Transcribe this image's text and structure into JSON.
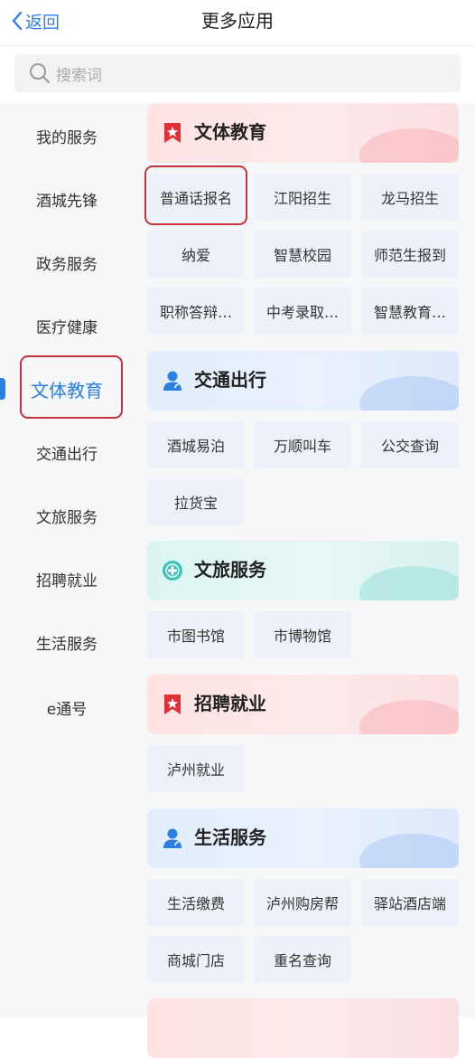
{
  "header": {
    "back_label": "返回",
    "title": "更多应用"
  },
  "search": {
    "placeholder": "搜索词"
  },
  "sidebar": {
    "items": [
      {
        "label": "我的服务"
      },
      {
        "label": "酒城先锋"
      },
      {
        "label": "政务服务"
      },
      {
        "label": "医疗健康"
      },
      {
        "label": "文体教育",
        "active": true
      },
      {
        "label": "交通出行"
      },
      {
        "label": "文旅服务"
      },
      {
        "label": "招聘就业"
      },
      {
        "label": "生活服务"
      },
      {
        "label": "e通号"
      }
    ]
  },
  "sections": [
    {
      "title": "文体教育",
      "icon": "bookmark-star-icon",
      "theme": "red",
      "apps": [
        "普通话报名",
        "江阳招生",
        "龙马招生",
        "纳爱",
        "智慧校园",
        "师范生报到",
        "职称答辩…",
        "中考录取…",
        "智慧教育…"
      ]
    },
    {
      "title": "交通出行",
      "icon": "person-icon",
      "theme": "blue",
      "apps": [
        "酒城易泊",
        "万顺叫车",
        "公交查询",
        "拉货宝"
      ]
    },
    {
      "title": "文旅服务",
      "icon": "plus-circle-icon",
      "theme": "teal",
      "apps": [
        "市图书馆",
        "市博物馆"
      ]
    },
    {
      "title": "招聘就业",
      "icon": "bookmark-star-icon",
      "theme": "red",
      "apps": [
        "泸州就业"
      ]
    },
    {
      "title": "生活服务",
      "icon": "person-icon",
      "theme": "blue",
      "apps": [
        "生活缴费",
        "泸州购房帮",
        "驿站酒店端",
        "商城门店",
        "重名查询"
      ]
    }
  ],
  "colors": {
    "accent": "#2b7fe0",
    "highlight_box": "#c8323a"
  }
}
